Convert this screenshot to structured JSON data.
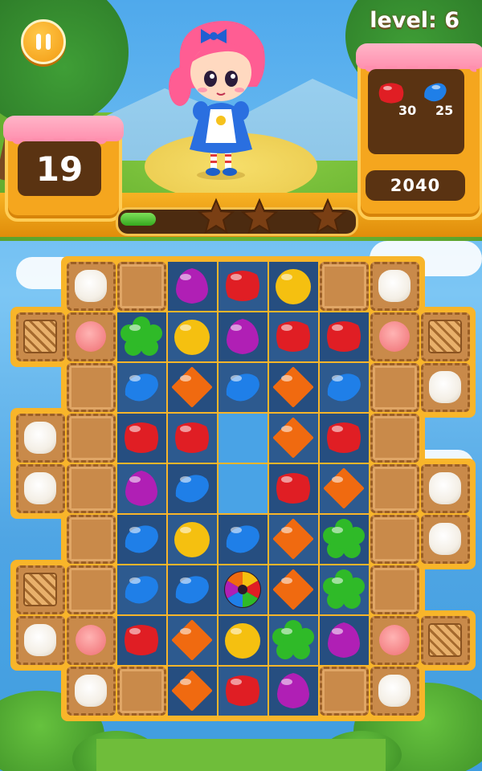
{
  "hud": {
    "level_text": "level: 6",
    "moves": "19",
    "score": "2040",
    "goals": [
      {
        "candy": "red",
        "count": "30"
      },
      {
        "candy": "blue",
        "count": "25"
      }
    ],
    "progress_fraction": 0.15,
    "stars_total": 3
  },
  "colors": {
    "red": "#e01e24",
    "blue": "#1f7fe8",
    "purple": "#b01fb5",
    "yellow": "#f5c010",
    "orange": "#f06a10",
    "green": "#2fba28",
    "frame": "#f8b52a"
  },
  "icons": {
    "pause": "pause-icon",
    "star": "star-icon",
    "color_bomb": "color-bomb-icon"
  },
  "board": {
    "rows": [
      [
        "none",
        "cream",
        "biscuit",
        "purple",
        "red",
        "yellow",
        "biscuit",
        "cream",
        "none"
      ],
      [
        "pie",
        "pink",
        "green",
        "yellow",
        "purple",
        "red",
        "red",
        "pink",
        "pie"
      ],
      [
        "none",
        "biscuit",
        "blue",
        "orange",
        "blue",
        "orange",
        "blue",
        "biscuit",
        "cream"
      ],
      [
        "cream",
        "biscuit",
        "red",
        "red",
        "hole",
        "orange",
        "red",
        "biscuit",
        "none"
      ],
      [
        "cream",
        "biscuit",
        "purple",
        "blue",
        "hole",
        "red",
        "orange",
        "biscuit",
        "cream"
      ],
      [
        "none",
        "biscuit",
        "blue",
        "yellow",
        "blue",
        "orange",
        "green",
        "biscuit",
        "cream"
      ],
      [
        "pie",
        "biscuit",
        "blue",
        "blue",
        "bomb",
        "orange",
        "green",
        "biscuit",
        "none"
      ],
      [
        "cream",
        "pink",
        "red",
        "orange",
        "yellow",
        "green",
        "purple",
        "pink",
        "pie"
      ],
      [
        "none",
        "cream",
        "biscuit",
        "orange",
        "red",
        "purple",
        "biscuit",
        "cream",
        "none"
      ]
    ]
  }
}
